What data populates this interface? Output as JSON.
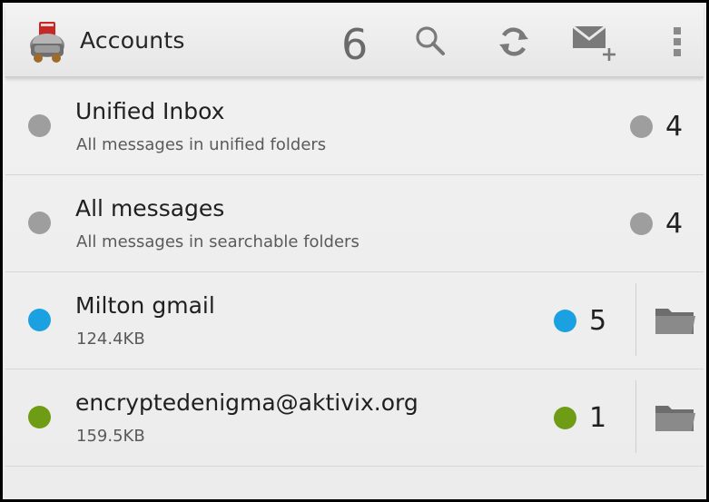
{
  "actionbar": {
    "title": "Accounts",
    "unread_count": "6",
    "app_icon": "k9-mail-dog-icon",
    "actions": [
      {
        "name": "search",
        "icon": "search-icon"
      },
      {
        "name": "refresh",
        "icon": "refresh-icon"
      },
      {
        "name": "compose",
        "icon": "compose-mail-icon"
      },
      {
        "name": "overflow",
        "icon": "overflow-menu-icon"
      }
    ]
  },
  "colors": {
    "gray_dot": "#9e9e9e",
    "blue_dot": "#1ba1e2",
    "green_dot": "#6e9d15",
    "folder_icon": "#7c7c7c"
  },
  "accounts": [
    {
      "name": "Unified Inbox",
      "description": "All messages in unified folders",
      "unread": "4",
      "color": "gray",
      "has_folders": false
    },
    {
      "name": "All messages",
      "description": "All messages in searchable folders",
      "unread": "4",
      "color": "gray",
      "has_folders": false
    },
    {
      "name": "Milton gmail",
      "description": "124.4KB",
      "unread": "5",
      "color": "blue",
      "has_folders": true
    },
    {
      "name": "encryptedenigma@aktivix.org",
      "description": "159.5KB",
      "unread": "1",
      "color": "green",
      "has_folders": true
    }
  ]
}
